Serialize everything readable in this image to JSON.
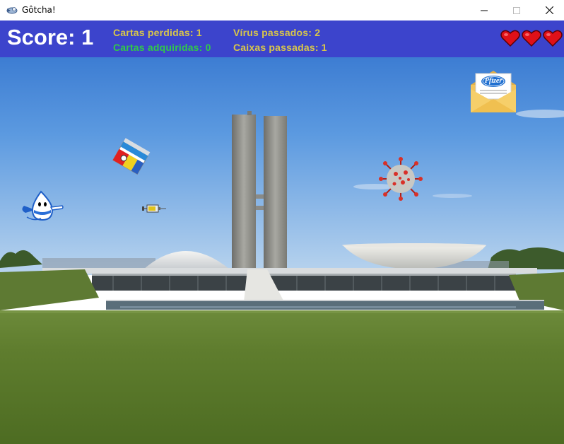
{
  "window": {
    "title": "Gôtcha!",
    "icon": "app-bird-icon",
    "controls": [
      "minimize-icon",
      "maximize-icon",
      "close-icon"
    ]
  },
  "hud": {
    "score_label": "Score: 1",
    "cartas_perdidas": "Cartas perdidas: 1",
    "cartas_adquiridas": "Cartas adquiridas: 0",
    "virus_passados": "Vírus passados: 2",
    "caixas_passadas": "Caixas passadas: 1",
    "lives": 3,
    "colors": {
      "bar": "#3c44cc",
      "yellow": "#d8c64a",
      "green": "#31c84a",
      "heart": "#e01018"
    }
  },
  "sprites": {
    "letter_brand": "Pfizer",
    "items": [
      "player-droplet",
      "syringe",
      "medicine-box",
      "coronavirus",
      "pfizer-letter"
    ]
  }
}
